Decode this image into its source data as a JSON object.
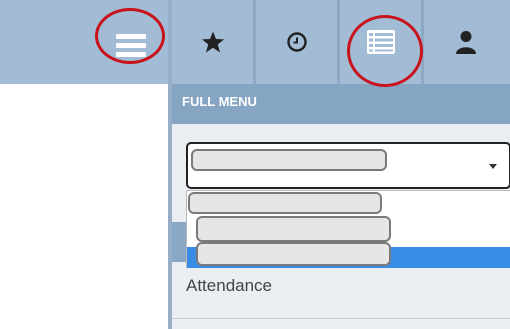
{
  "header": {
    "menu_title": "FULL MENU"
  },
  "tabs": [
    {
      "icon": "star-icon"
    },
    {
      "icon": "clock-icon"
    },
    {
      "icon": "list-icon"
    },
    {
      "icon": "user-icon"
    }
  ],
  "menu": {
    "items": [
      "Attendance"
    ]
  },
  "colors": {
    "tabbar": "#a2bcd6",
    "header": "#86a5c3",
    "highlight": "#3a8de6",
    "annotation": "#c8121c"
  }
}
